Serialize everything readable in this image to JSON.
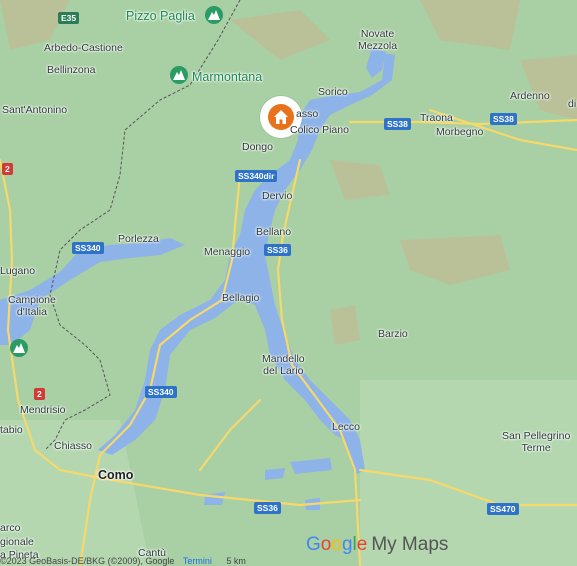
{
  "map": {
    "colors": {
      "land": "#a9cfa4",
      "water": "#8db3e8",
      "road": "#f6d86b",
      "border": "#555555",
      "marker": "#e8711b"
    },
    "peaks": {
      "pizzo_paglia": "Pizzo Paglia",
      "marmontana": "Marmontana"
    },
    "places": {
      "arbedo": "Arbedo-Castione",
      "bellinzona": "Bellinzona",
      "sant_antonino": "Sant'Antonino",
      "novate": "Novate\nMezzola",
      "sorico": "Sorico",
      "gravedona": "asso",
      "colico": "Colico Piano",
      "traona": "Traona",
      "morbegno": "Morbegno",
      "ardenno": "Ardenno",
      "di": "di",
      "dongo": "Dongo",
      "dervio": "Dervio",
      "porlezza": "Porlezza",
      "menaggio": "Menaggio",
      "bellano": "Bellano",
      "lugano": "Lugano",
      "campione": "Campione\nd'Italia",
      "bellagio": "Bellagio",
      "barzio": "Barzio",
      "mandello": "Mandello\ndel Lario",
      "mendrisio": "Mendrisio",
      "stabio": "tabio",
      "chiasso": "Chiasso",
      "lecco": "Lecco",
      "san_pellegrino": "San Pellegrino\nTerme",
      "como": "Como",
      "cantu": "Cantù",
      "arco": "arco",
      "gionale": "gionale",
      "pineta": "a Pineta"
    },
    "roads": {
      "e35": "E35",
      "ss38_a": "SS38",
      "ss38_b": "SS38",
      "ss340dir": "SS340dir",
      "ss340_a": "SS340",
      "ss36_a": "SS36",
      "ss340_b": "SS340",
      "ss36_b": "SS36",
      "ss470": "SS470",
      "r2_a": "2",
      "r2_b": "2"
    },
    "icons": {
      "peak": "mountain-icon",
      "home": "home-icon",
      "pin": "map-pin-icon"
    }
  },
  "branding": {
    "google": [
      "G",
      "o",
      "o",
      "g",
      "l",
      "e"
    ],
    "product": "My Maps"
  },
  "footer": {
    "attribution": "©2023 GeoBasis-DE/BKG (©2009), Google",
    "terms": "Termini",
    "scale": "5 km"
  }
}
